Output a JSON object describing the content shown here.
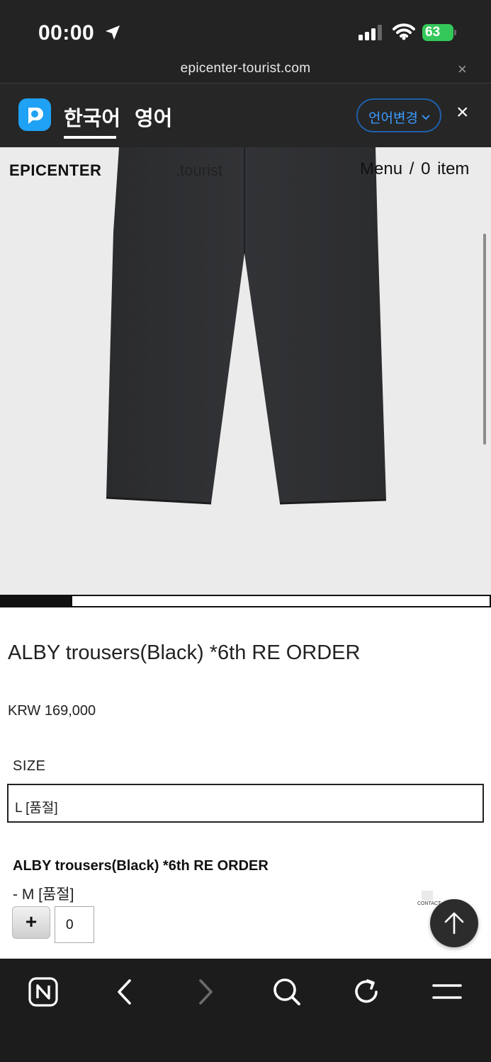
{
  "status_bar": {
    "time": "00:00",
    "battery": "63",
    "icons": [
      "location-arrow-icon",
      "signal-icon",
      "wifi-icon",
      "battery-charging-icon"
    ]
  },
  "browser": {
    "url": "epicenter-tourist.com",
    "close_icon": "×"
  },
  "translate_bar": {
    "languages": [
      "한국어",
      "영어"
    ],
    "active_language": "한국어",
    "change_button": "언어변경",
    "close_icon": "×",
    "accent_color": "#3b9cff"
  },
  "site_header": {
    "brand": "EPICENTER",
    "brand_suffix": ".tourist",
    "menu": "Menu",
    "separator": "/",
    "cart": "0 item"
  },
  "product": {
    "image_progress": 0.145,
    "title": "ALBY trousers(Black) *6th RE ORDER",
    "price": "KRW 169,000",
    "size_label": "SIZE",
    "size_selected": "L [품절]",
    "option": {
      "title": "ALBY trousers(Black) *6th RE ORDER",
      "size": "- M [품절]",
      "plus_label": "+",
      "quantity": "0"
    }
  },
  "floating": {
    "contact_label": "CONTACT",
    "scroll_top_icon": "arrow-up-icon"
  },
  "toolbar": {
    "buttons": [
      "naver-home-icon",
      "back-icon",
      "forward-icon",
      "search-icon",
      "reload-icon",
      "menu-icon"
    ]
  }
}
